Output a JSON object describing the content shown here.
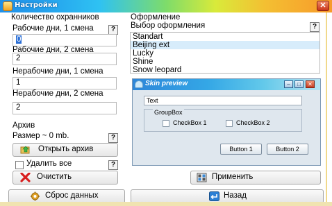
{
  "window": {
    "title": "Настройки",
    "close_glyph": "✕"
  },
  "guards": {
    "heading": "Количество охранников",
    "weekday1": {
      "label": "Рабочие дни, 1 смена",
      "value": "0"
    },
    "weekday2": {
      "label": "Рабочие дни, 2 смена",
      "value": "2"
    },
    "weekend1": {
      "label": "Нерабочие дни, 1 смена",
      "value": "1"
    },
    "weekend2": {
      "label": "Нерабочие дни, 2 смена",
      "value": "2"
    },
    "help_glyph": "?"
  },
  "archive": {
    "heading": "Архив",
    "size_text": "Размер ~ 0 mb.",
    "open_label": "Открыть архив",
    "delete_all_label": "Удалить все",
    "delete_all_checked": false,
    "clear_label": "Очистить"
  },
  "reset_label": "Сброс данных",
  "appearance": {
    "heading": "Оформление",
    "select_label": "Выбор оформления",
    "skins": [
      "Standart",
      "Beijing ext",
      "Lucky",
      "Shine",
      "Snow leopard"
    ],
    "selected_index": 1,
    "apply_label": "Применить"
  },
  "preview": {
    "title": "Skin preview",
    "textbox_value": "Text",
    "groupbox_title": "GroupBox",
    "checkbox1": "CheckBox 1",
    "checkbox2": "CheckBox 2",
    "button1": "Button 1",
    "button2": "Button 2",
    "min_glyph": "–",
    "max_glyph": "□",
    "close_glyph": "✕"
  },
  "back_label": "Назад",
  "icons": {
    "title": "settings-app-icon",
    "open_archive": "folder-up-icon",
    "clear": "red-x-icon",
    "reset": "gear-icon",
    "apply": "apply-grid-icon",
    "back": "back-arrow-icon"
  },
  "colors": {
    "selection": "#2b6fd6",
    "list_selected": "#d7ecfb",
    "danger": "#d81e1e"
  }
}
